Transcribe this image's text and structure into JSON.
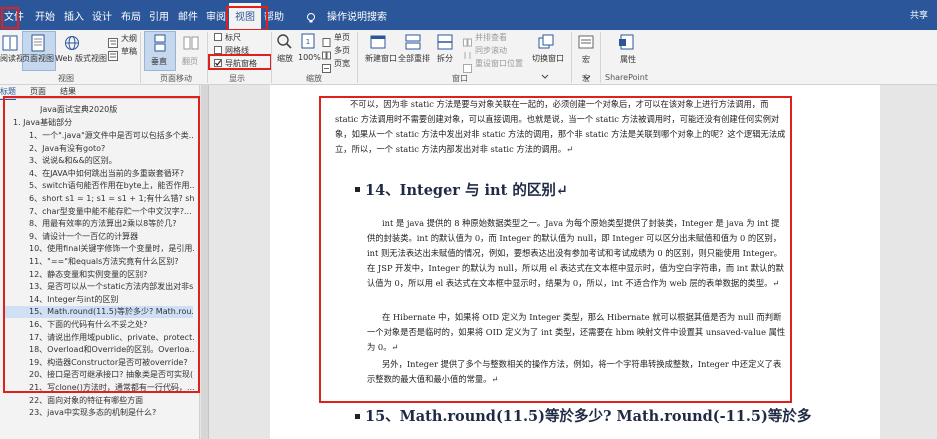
{
  "menubar": {
    "items": [
      "文件",
      "开始",
      "插入",
      "设计",
      "布局",
      "引用",
      "邮件",
      "审阅",
      "视图",
      "帮助"
    ],
    "tell_me": "操作说明搜索",
    "share": "共享"
  },
  "ribbon": {
    "views": {
      "read_mode": "阅读视图",
      "print_layout": "页面视图",
      "web_layout": "Web 版式视图",
      "outline": "大纲",
      "draft": "草稿",
      "group": "视图"
    },
    "page_movement": {
      "vertical": "垂直",
      "side_to_side": "翻页",
      "group": "页面移动"
    },
    "show": {
      "ruler": "标尺",
      "gridlines": "网格线",
      "nav_pane": "导航窗格",
      "group": "显示",
      "nav_pane_checked": true
    },
    "zoom": {
      "zoom": "缩放",
      "hundred": "100%",
      "one_page": "单页",
      "multi_page": "多页",
      "page_width": "页宽",
      "group": "缩放"
    },
    "window": {
      "new_window": "新建窗口",
      "arrange_all": "全部重排",
      "split": "拆分",
      "side_by_side": "并排查看",
      "sync_scroll": "同步滚动",
      "reset_position": "重设窗口位置",
      "switch_windows": "切换窗口",
      "group": "窗口"
    },
    "macros": {
      "label": "宏",
      "group": "宏"
    },
    "sharepoint": {
      "label": "属性",
      "group": "SharePoint"
    }
  },
  "nav_pane": {
    "tabs": [
      "标题",
      "页面",
      "结果"
    ],
    "root": "Java面试宝典2020版",
    "section": "1. Java基础部分",
    "items": [
      "1、一个\".java\"源文件中是否可以包括多个类...",
      "2、Java有没有goto?",
      "3、说说&和&&的区别。",
      "4、在JAVA中如何跳出当前的多重嵌套循环?",
      "5、switch语句能否作用在byte上，能否作用...",
      "6、short s1 = 1; s1 = s1 + 1;有什么错? shor...",
      "7、char型变量中能不能存贮一个中文汉字?...",
      "8、用最有效率的方法算出2乘以8等於几?",
      "9、请设计一个一百亿的计算器",
      "10、使用final关键字修饰一个变量时，是引用...",
      "11、\"==\"和equals方法究竟有什么区别?",
      "12、静态变量和实例变量的区别?",
      "13、是否可以从一个static方法内部发出对非s...",
      "14、Integer与int的区别",
      "15、Math.round(11.5)等於多少? Math.rou...",
      "16、下面的代码有什么不妥之处?",
      "17、请说出作用域public、private、protect...",
      "18、Overload和Override的区别。Overloa...",
      "19、构造器Constructor是否可被override?",
      "20、接口是否可继承接口? 抽象类是否可实现(...",
      "21、写clone()方法时，通常都有一行代码，...",
      "22、面向对象的特征有哪些方面",
      "23、java中实现多态的机制是什么?"
    ],
    "selected_index": 14
  },
  "document": {
    "intro_para": "不可以，因为非 static 方法是要与对象关联在一起的，必须创建一个对象后，才可以在该对象上进行方法调用，而 static 方法调用时不需要创建对象，可以直接调用。也就是说，当一个 static 方法被调用时，可能还没有创建任何实例对象，如果从一个 static 方法中发出对非 static 方法的调用，那个非 static 方法是关联到哪个对象上的呢？这个逻辑无法成立，所以，一个 static 方法内部发出对非 static 方法的调用。↵",
    "heading14": "14、Integer 与 int 的区别↵",
    "para1": "int 是 java 提供的 8 种原始数据类型之一。Java 为每个原始类型提供了封装类，Integer 是 java 为 int 提供的封装类。int 的默认值为 0，而 Integer 的默认值为 null，即 Integer 可以区分出未赋值和值为 0 的区别，int 则无法表达出未赋值的情况，例如，要想表达出没有参加考试和考试成绩为 0 的区别，则只能使用 Integer。在 JSP 开发中，Integer 的默认为 null，所以用 el 表达式在文本框中显示时，值为空白字符串，而 int 默认的默认值为 0，所以用 el 表达式在文本框中显示时，结果为 0，所以，int 不适合作为 web 层的表单数据的类型。↵",
    "para2": "在 Hibernate 中，如果将 OID 定义为 Integer 类型，那么 Hibernate 就可以根据其值是否为 null 而判断一个对象是否是临时的，如果将 OID 定义为了 int 类型，还需要在 hbm 映射文件中设置其 unsaved-value 属性为 0。↵",
    "para3": "另外，Integer 提供了多个与整数相关的操作方法，例如，将一个字符串转换成整数，Integer 中还定义了表示整数的最大值和最小值的常量。↵",
    "heading15": "15、Math.round(11.5)等於多少? Math.round(-11.5)等於多"
  },
  "colors": {
    "accent": "#2b579a",
    "highlight": "#e0201c",
    "selection": "#cfe0f5"
  }
}
